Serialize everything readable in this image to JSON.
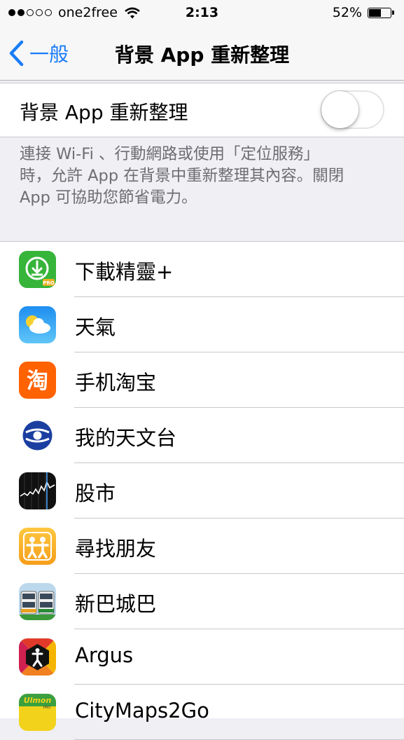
{
  "status_bar": {
    "carrier": "one2free",
    "time": "2:13",
    "battery_pct": "52%"
  },
  "nav": {
    "back_label": "一般",
    "title": "背景 App 重新整理"
  },
  "toggle": {
    "label": "背景 App 重新整理",
    "state": "off"
  },
  "footer": {
    "lines": [
      "連接 Wi-Fi 、行動網路或使用「定位服務」",
      "時，允許 App 在背景中重新整理其內容。關閉",
      "App 可協助您節省電力。"
    ]
  },
  "apps": [
    {
      "name": "下載精靈+",
      "icon": "download-pro-icon"
    },
    {
      "name": "天氣",
      "icon": "weather-icon"
    },
    {
      "name": "手机淘宝",
      "icon": "taobao-icon"
    },
    {
      "name": "我的天文台",
      "icon": "my-observatory-icon"
    },
    {
      "name": "股市",
      "icon": "stocks-icon"
    },
    {
      "name": "尋找朋友",
      "icon": "find-friends-icon"
    },
    {
      "name": "新巴城巴",
      "icon": "bus-icon"
    },
    {
      "name": "Argus",
      "icon": "argus-icon"
    },
    {
      "name": "CityMaps2Go",
      "icon": "citymaps-icon"
    }
  ],
  "colors": {
    "accent": "#1a7cf6",
    "background": "#efeff4",
    "footer_text": "#6d6d72"
  }
}
